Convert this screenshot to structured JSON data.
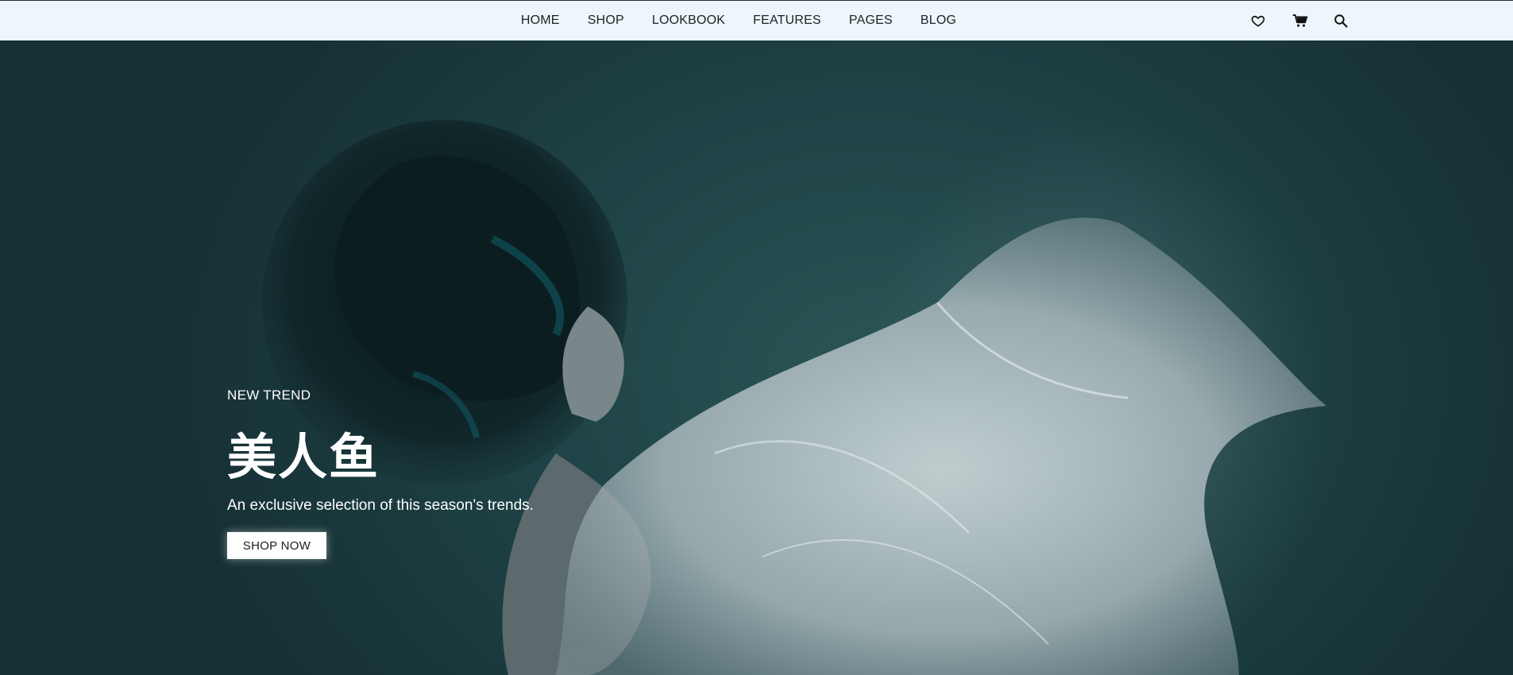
{
  "nav": {
    "items": [
      {
        "label": "HOME"
      },
      {
        "label": "SHOP"
      },
      {
        "label": "LOOKBOOK"
      },
      {
        "label": "FEATURES"
      },
      {
        "label": "PAGES"
      },
      {
        "label": "BLOG"
      }
    ],
    "icons": [
      "heart-icon",
      "cart-icon",
      "search-icon"
    ]
  },
  "hero": {
    "kicker": "NEW TREND",
    "title": "美人鱼",
    "subtitle": "An exclusive selection of this season's trends.",
    "cta_label": "SHOP NOW"
  },
  "colors": {
    "nav_bg": "#ecf6fc",
    "hero_bg": "#1f4447",
    "text_light": "#ffffff",
    "button_bg": "#ffffff"
  }
}
